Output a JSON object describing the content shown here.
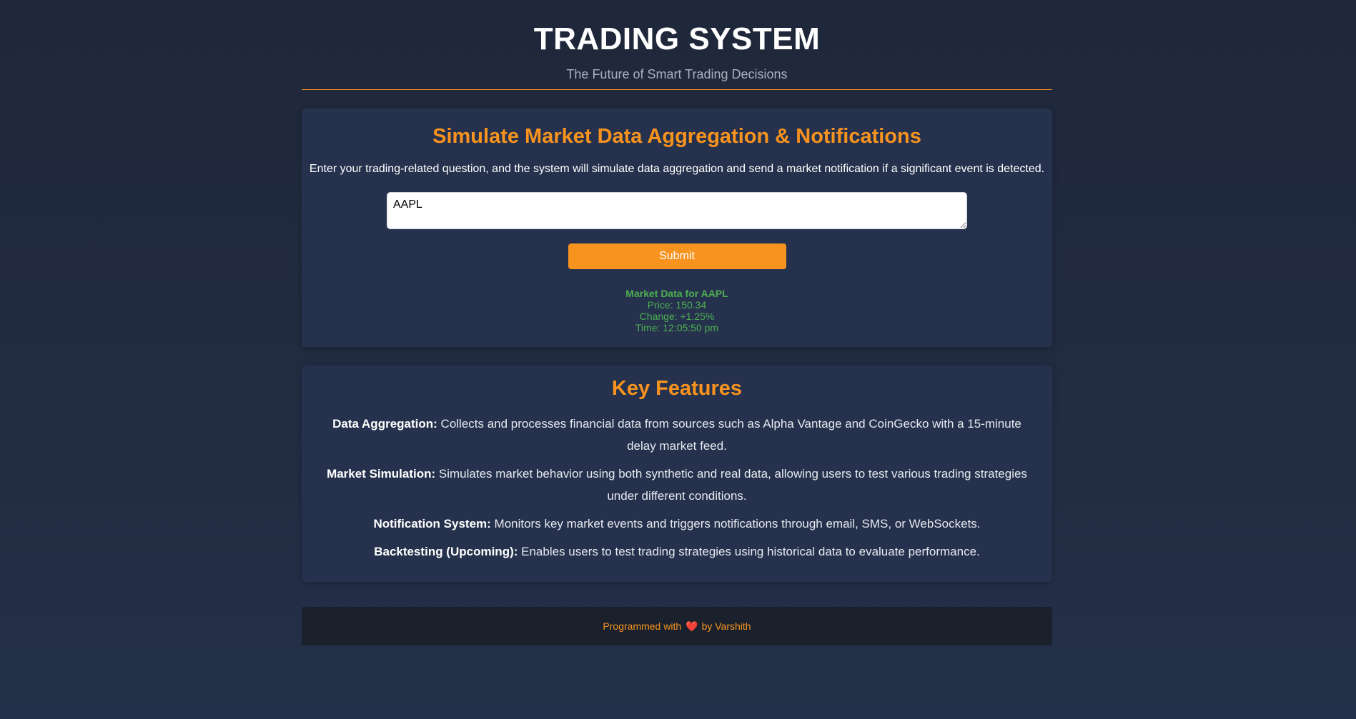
{
  "header": {
    "title": "TRADING SYSTEM",
    "subtitle": "The Future of Smart Trading Decisions"
  },
  "simulator": {
    "title": "Simulate Market Data Aggregation & Notifications",
    "description": "Enter your trading-related question, and the system will simulate data aggregation and send a market notification if a significant event is detected.",
    "query_value": "AAPL",
    "submit_label": "Submit",
    "result": {
      "heading": "Market Data for AAPL",
      "price": "Price: 150.34",
      "change": "Change: +1.25%",
      "time": "Time: 12:05:50 pm"
    }
  },
  "features": {
    "title": "Key Features",
    "items": [
      {
        "label": "Data Aggregation:",
        "text": " Collects and processes financial data from sources such as Alpha Vantage and CoinGecko with a 15-minute delay market feed."
      },
      {
        "label": "Market Simulation:",
        "text": " Simulates market behavior using both synthetic and real data, allowing users to test various trading strategies under different conditions."
      },
      {
        "label": "Notification System:",
        "text": " Monitors key market events and triggers notifications through email, SMS, or WebSockets."
      },
      {
        "label": "Backtesting (Upcoming):",
        "text": " Enables users to test trading strategies using historical data to evaluate performance."
      }
    ]
  },
  "footer": {
    "prefix": "Programmed with",
    "icon": "heart-icon",
    "suffix": "by Varshith"
  },
  "colors": {
    "accent": "#f7931e",
    "success": "#4caf50",
    "card_bg": "#26324d",
    "page_bg": "#1f2739"
  }
}
